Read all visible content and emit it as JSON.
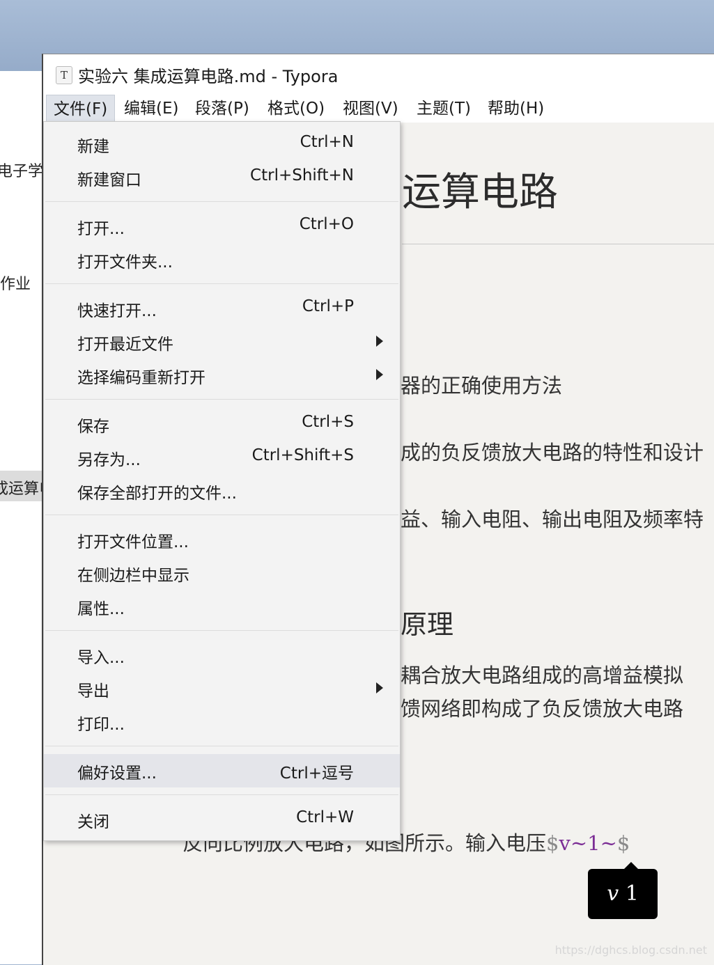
{
  "background_window": {
    "items": [
      "电子学",
      "作业",
      "成运算电"
    ]
  },
  "window": {
    "title": "实验六 集成运算电路.md - Typora",
    "app_icon_letter": "T"
  },
  "menubar": {
    "items": [
      "文件(F)",
      "编辑(E)",
      "段落(P)",
      "格式(O)",
      "视图(V)",
      "主题(T)",
      "帮助(H)"
    ],
    "active_index": 0
  },
  "file_menu": {
    "new": {
      "label": "新建",
      "shortcut": "Ctrl+N"
    },
    "new_window": {
      "label": "新建窗口",
      "shortcut": "Ctrl+Shift+N"
    },
    "open": {
      "label": "打开...",
      "shortcut": "Ctrl+O"
    },
    "open_folder": {
      "label": "打开文件夹..."
    },
    "quick_open": {
      "label": "快速打开...",
      "shortcut": "Ctrl+P"
    },
    "open_recent": {
      "label": "打开最近文件"
    },
    "reopen_encoding": {
      "label": "选择编码重新打开"
    },
    "save": {
      "label": "保存",
      "shortcut": "Ctrl+S"
    },
    "save_as": {
      "label": "另存为...",
      "shortcut": "Ctrl+Shift+S"
    },
    "save_all": {
      "label": "保存全部打开的文件..."
    },
    "open_location": {
      "label": "打开文件位置..."
    },
    "reveal_sidebar": {
      "label": "在侧边栏中显示"
    },
    "properties": {
      "label": "属性..."
    },
    "import": {
      "label": "导入..."
    },
    "export": {
      "label": "导出"
    },
    "print": {
      "label": "打印..."
    },
    "preferences": {
      "label": "偏好设置...",
      "shortcut": "Ctrl+逗号"
    },
    "close": {
      "label": "关闭",
      "shortcut": "Ctrl+W"
    }
  },
  "document": {
    "heading_fragment": "运算电路",
    "para1": "器的正确使用方法",
    "para2": "成的负反馈放大电路的特性和设计",
    "para3": "益、输入电阻、输出电阻及频率特",
    "h2_fragment": "原理",
    "para4": "耦合放大电路组成的高增益模拟",
    "para5": "馈网络即构成了负反馈放大电路",
    "bottom_text": "反向比例放大电路，如图所示。输入电压",
    "math_prefix": "$",
    "math_var": "v~1~",
    "math_suffix": "$",
    "math_preview": "v 1",
    "math_preview_var": "v",
    "math_preview_sub": "1"
  },
  "watermark": "https://dghcs.blog.csdn.net"
}
